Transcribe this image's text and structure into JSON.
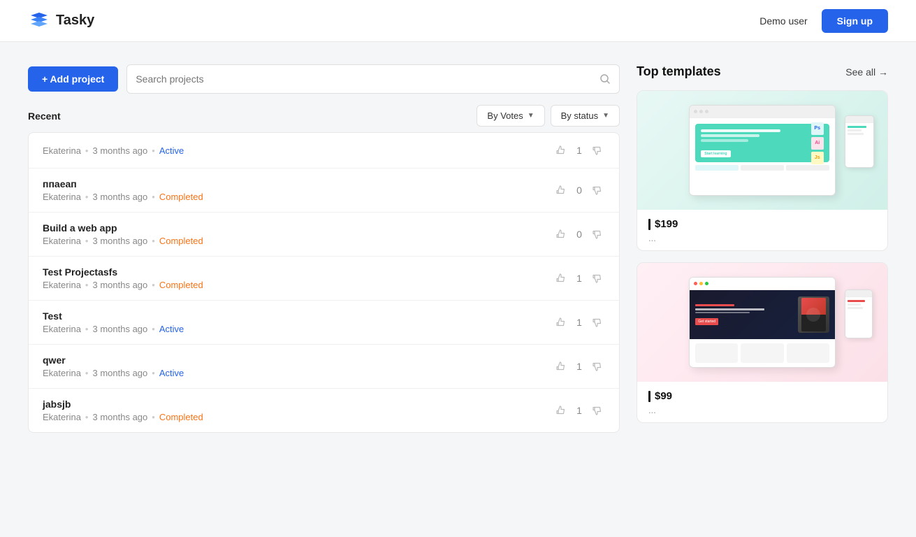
{
  "header": {
    "logo_text": "Tasky",
    "demo_user_label": "Demo user",
    "signup_label": "Sign up"
  },
  "toolbar": {
    "add_project_label": "+ Add project",
    "search_placeholder": "Search projects"
  },
  "projects_section": {
    "recent_label": "Recent",
    "filter_votes_label": "By Votes",
    "filter_status_label": "By status"
  },
  "projects": [
    {
      "title": "",
      "author": "Ekaterina",
      "time": "3 months ago",
      "status": "Active",
      "status_type": "active",
      "votes": 1
    },
    {
      "title": "ппаеап",
      "author": "Ekaterina",
      "time": "3 months ago",
      "status": "Completed",
      "status_type": "completed",
      "votes": 0
    },
    {
      "title": "Build a web app",
      "author": "Ekaterina",
      "time": "3 months ago",
      "status": "Completed",
      "status_type": "completed",
      "votes": 0
    },
    {
      "title": "Test Projectasfs",
      "author": "Ekaterina",
      "time": "3 months ago",
      "status": "Completed",
      "status_type": "completed",
      "votes": 1
    },
    {
      "title": "Test",
      "author": "Ekaterina",
      "time": "3 months ago",
      "status": "Active",
      "status_type": "active",
      "votes": 1
    },
    {
      "title": "qwer",
      "author": "Ekaterina",
      "time": "3 months ago",
      "status": "Active",
      "status_type": "active",
      "votes": 1
    },
    {
      "title": "jabsjb",
      "author": "Ekaterina",
      "time": "3 months ago",
      "status": "Completed",
      "status_type": "completed",
      "votes": 1
    }
  ],
  "templates_section": {
    "title": "Top templates",
    "see_all_label": "See all →"
  },
  "templates": [
    {
      "price": "$199",
      "dots": "..."
    },
    {
      "price": "$99",
      "dots": "..."
    }
  ]
}
